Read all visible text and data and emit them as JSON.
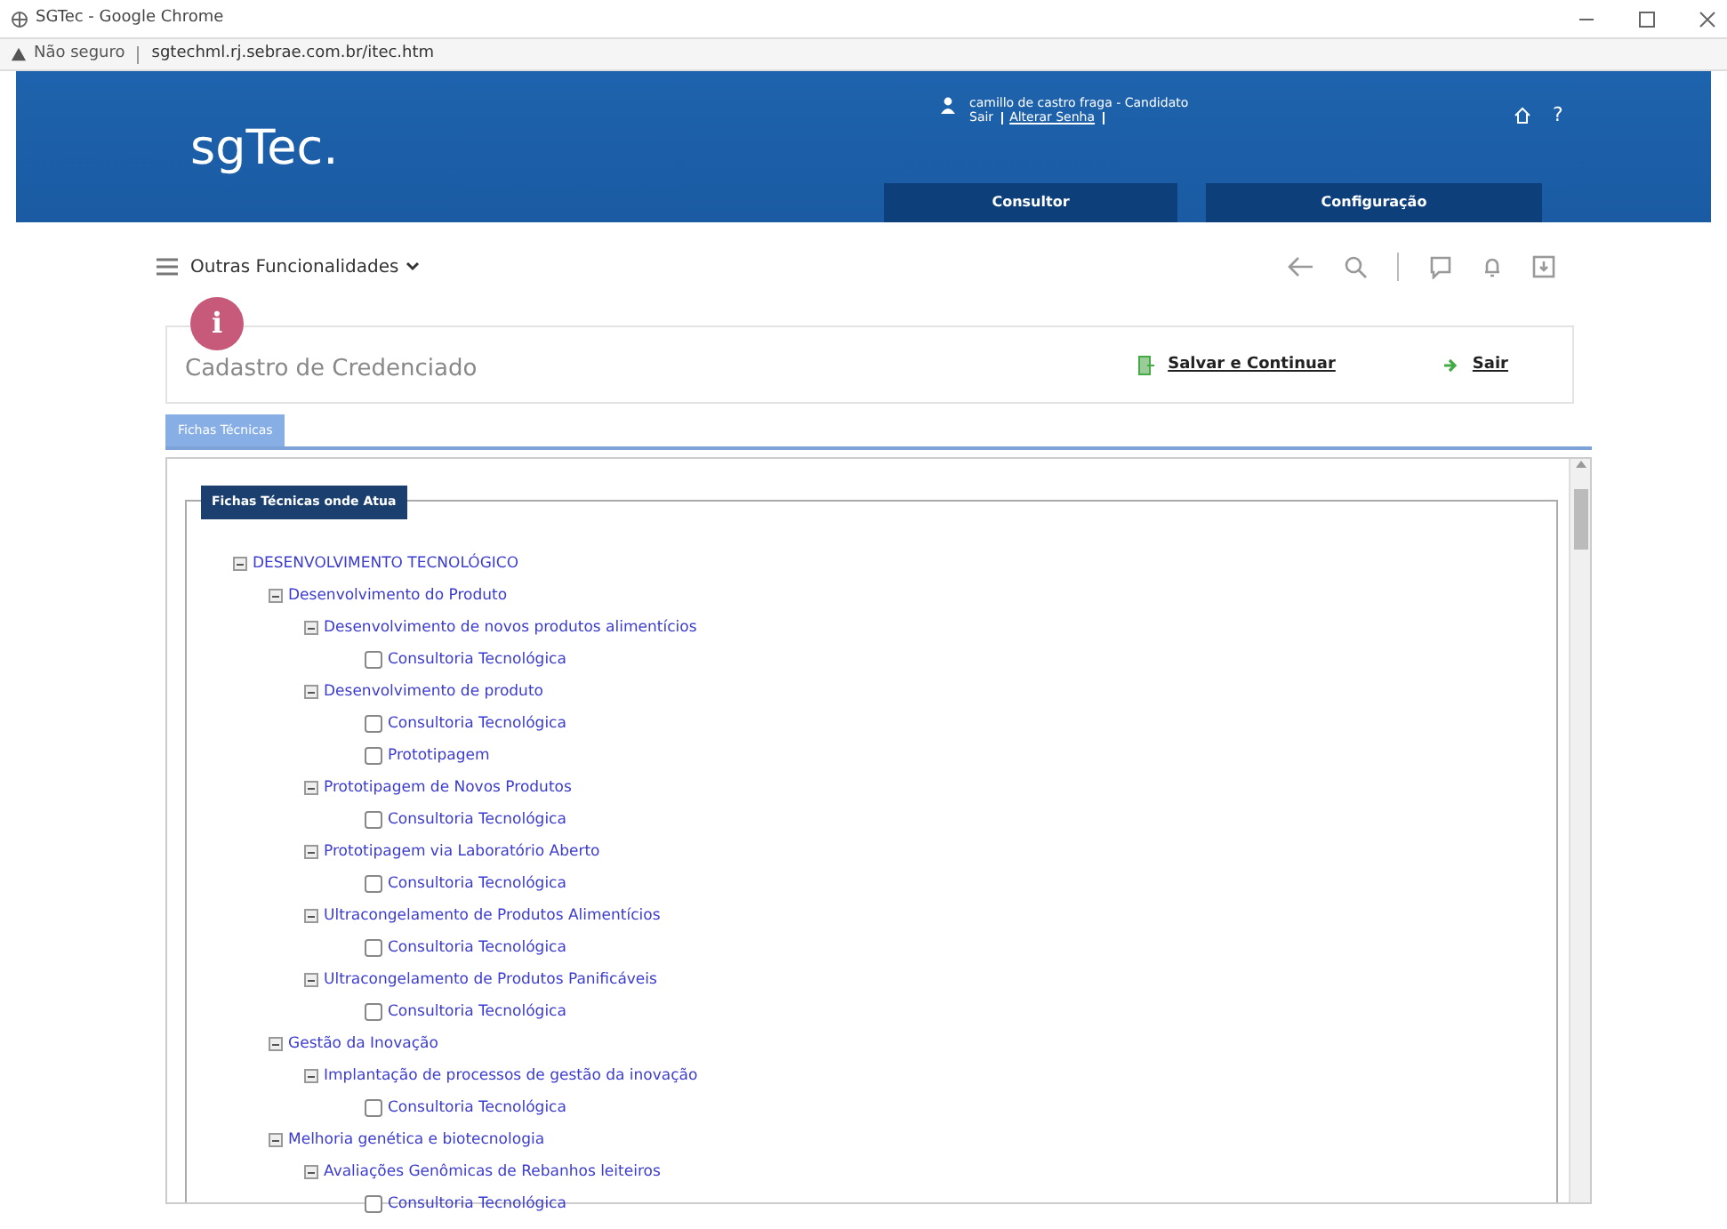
{
  "window": {
    "title": "SGTec - Google Chrome"
  },
  "address_bar": {
    "security": "Não seguro",
    "url": "sgtechml.rj.sebrae.com.br/itec.htm"
  },
  "header": {
    "logo": "sgTec.",
    "user": "camillo de castro fraga - Candidato",
    "user_links": [
      "Sair",
      "Alterar Senha"
    ],
    "help": "?",
    "nav": [
      {
        "label": "Consultor",
        "selected": false
      },
      {
        "label": "Configuração",
        "selected": false
      }
    ]
  },
  "toolbar": {
    "menu": "Outras Funcionalidades"
  },
  "form": {
    "info_badge": "i",
    "title": "Cadastro de Credenciado",
    "actions": [
      "Salvar e Continuar",
      "Sair"
    ]
  },
  "tabs": [
    {
      "label": "Fichas Técnicas",
      "selected": true
    }
  ],
  "fieldset": {
    "legend": "Fichas Técnicas onde Atua",
    "tree": [
      {
        "label": "DESENVOLVIMENTO TECNOLÓGICO",
        "expanded": true,
        "children": [
          {
            "label": "Desenvolvimento do Produto",
            "expanded": true,
            "children": [
              {
                "label": "Desenvolvimento de novos produtos alimentícios",
                "expanded": true,
                "children": [
                  {
                    "label": "Consultoria Tecnológica",
                    "checked": false
                  }
                ]
              },
              {
                "label": "Desenvolvimento de produto",
                "expanded": true,
                "children": [
                  {
                    "label": "Consultoria Tecnológica",
                    "checked": false
                  },
                  {
                    "label": "Prototipagem",
                    "checked": false
                  }
                ]
              },
              {
                "label": "Prototipagem de Novos Produtos",
                "expanded": true,
                "children": [
                  {
                    "label": "Consultoria Tecnológica",
                    "checked": false
                  }
                ]
              },
              {
                "label": "Prototipagem via Laboratório Aberto",
                "expanded": true,
                "children": [
                  {
                    "label": "Consultoria Tecnológica",
                    "checked": false
                  }
                ]
              },
              {
                "label": "Ultracongelamento de Produtos Alimentícios",
                "expanded": true,
                "children": [
                  {
                    "label": "Consultoria Tecnológica",
                    "checked": false
                  }
                ]
              },
              {
                "label": "Ultracongelamento de Produtos Panificáveis",
                "expanded": true,
                "children": [
                  {
                    "label": "Consultoria Tecnológica",
                    "checked": false
                  }
                ]
              }
            ]
          },
          {
            "label": "Gestão da Inovação",
            "expanded": true,
            "children": [
              {
                "label": "Implantação de processos de gestão da inovação",
                "expanded": true,
                "children": [
                  {
                    "label": "Consultoria Tecnológica",
                    "checked": false
                  }
                ]
              }
            ]
          },
          {
            "label": "Melhoria genética e biotecnologia",
            "expanded": true,
            "children": [
              {
                "label": "Avaliações Genômicas de Rebanhos leiteiros",
                "expanded": true,
                "children": [
                  {
                    "label": "Consultoria Tecnológica",
                    "checked": false
                  }
                ]
              }
            ]
          }
        ]
      }
    ]
  }
}
